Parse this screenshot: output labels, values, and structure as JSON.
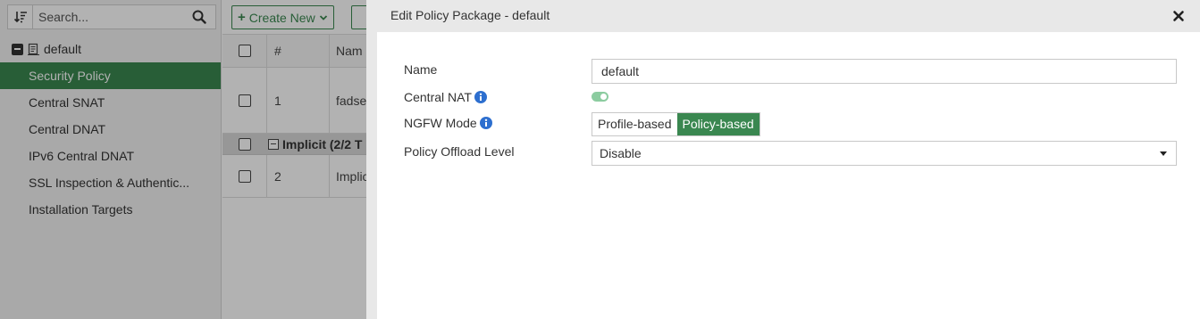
{
  "sidebar": {
    "search_placeholder": "Search...",
    "root_label": "default",
    "items": [
      {
        "label": "Security Policy",
        "active": true
      },
      {
        "label": "Central SNAT",
        "active": false
      },
      {
        "label": "Central DNAT",
        "active": false
      },
      {
        "label": "IPv6 Central DNAT",
        "active": false
      },
      {
        "label": "SSL Inspection & Authentic...",
        "active": false
      },
      {
        "label": "Installation Targets",
        "active": false
      }
    ]
  },
  "toolbar": {
    "create_label": "Create New"
  },
  "grid": {
    "headers": {
      "num": "#",
      "name": "Nam"
    },
    "rows": [
      {
        "num": "1",
        "name": "fadse"
      }
    ],
    "section_label": "Implicit (2/2 T",
    "rows2": [
      {
        "num": "2",
        "name": "Implic"
      }
    ]
  },
  "dialog": {
    "title": "Edit Policy Package - default",
    "fields": {
      "name_label": "Name",
      "name_value": "default",
      "central_nat_label": "Central NAT",
      "central_nat_enabled": true,
      "ngfw_label": "NGFW Mode",
      "ngfw_options": [
        "Profile-based",
        "Policy-based"
      ],
      "ngfw_selected": "Policy-based",
      "offload_label": "Policy Offload Level",
      "offload_value": "Disable"
    }
  },
  "colors": {
    "accent": "#3a8750",
    "info": "#2d6fcf"
  }
}
